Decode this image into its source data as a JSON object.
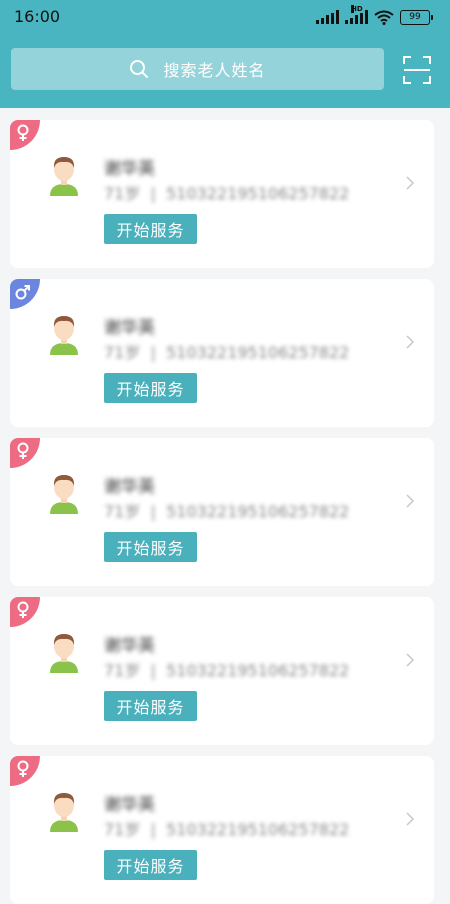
{
  "status_bar": {
    "time": "16:00",
    "hd_label": "HD",
    "battery": "99"
  },
  "search": {
    "placeholder": "搜索老人姓名",
    "icon": "search-icon",
    "scan_icon": "scan-icon"
  },
  "colors": {
    "header": "#49b5c0",
    "search_bg": "#94d3d9",
    "button": "#4ab1bc",
    "female_badge": "#ee6b84",
    "male_badge": "#6c86e0"
  },
  "elders": [
    {
      "gender": "female",
      "gender_symbol": "♀",
      "name": "谢华英",
      "age": "71岁",
      "id_number": "510322195106257822",
      "action_label": "开始服务"
    },
    {
      "gender": "male",
      "gender_symbol": "♂",
      "name": "谢华英",
      "age": "71岁",
      "id_number": "510322195106257822",
      "action_label": "开始服务"
    },
    {
      "gender": "female",
      "gender_symbol": "♀",
      "name": "谢华英",
      "age": "71岁",
      "id_number": "510322195106257822",
      "action_label": "开始服务"
    },
    {
      "gender": "female",
      "gender_symbol": "♀",
      "name": "谢华英",
      "age": "71岁",
      "id_number": "510322195106257822",
      "action_label": "开始服务"
    },
    {
      "gender": "female",
      "gender_symbol": "♀",
      "name": "谢华英",
      "age": "71岁",
      "id_number": "510322195106257822",
      "action_label": "开始服务"
    }
  ]
}
